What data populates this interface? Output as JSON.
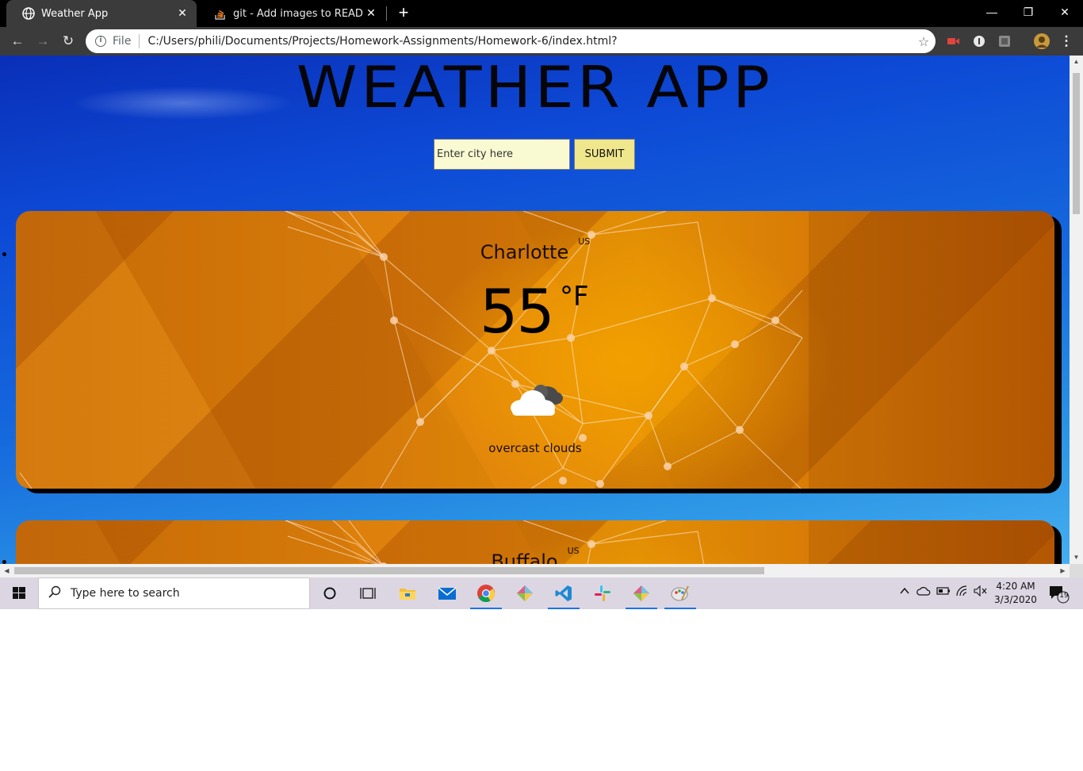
{
  "browser": {
    "tabs": [
      {
        "title": "Weather App",
        "active": true
      },
      {
        "title": "git - Add images to README.md",
        "active": false
      }
    ],
    "address": {
      "scheme_label": "File",
      "url": "C:/Users/phili/Documents/Projects/Homework-Assignments/Homework-6/index.html?"
    }
  },
  "page": {
    "title": "WEATHER APP",
    "search": {
      "placeholder": "Enter city here",
      "value": ""
    },
    "submit_label": "SUBMIT",
    "cards": [
      {
        "city": "Charlotte",
        "country": "US",
        "temp": "55",
        "unit": "°F",
        "icon": "overcast-clouds-icon",
        "description": "overcast clouds"
      },
      {
        "city": "Buffalo",
        "country": "US"
      }
    ]
  },
  "taskbar": {
    "search_placeholder": "Type here to search",
    "time": "4:20 AM",
    "date": "3/3/2020",
    "notification_count": "19",
    "pinned": [
      "cortana-icon",
      "task-view-icon",
      "file-explorer-icon",
      "mail-icon",
      "chrome-icon",
      "gitkraken-icon",
      "vscode-icon",
      "slack-icon",
      "gitkraken-icon",
      "paint-icon"
    ]
  },
  "colors": {
    "accent": "#1a73e8",
    "input_bg": "#fafad2",
    "button_bg": "#f0e68c",
    "card_orange": "#d67b0a"
  }
}
